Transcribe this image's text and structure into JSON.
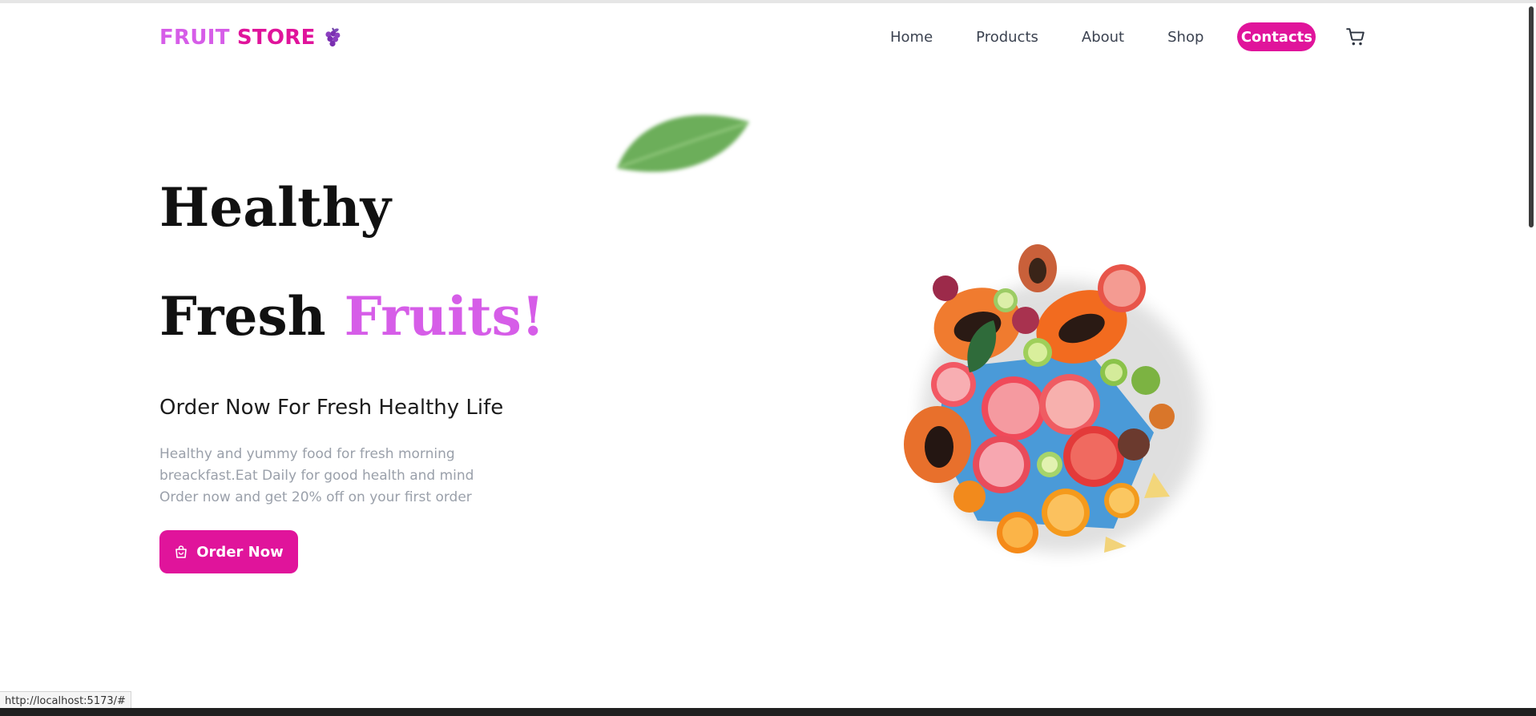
{
  "brand": {
    "word1": "FRUIT",
    "word2": "STORE",
    "icon": "grape-icon"
  },
  "nav": {
    "links": [
      "Home",
      "Products",
      "About",
      "Shop"
    ],
    "contact_label": "Contacts",
    "cart_icon": "cart-icon"
  },
  "hero": {
    "line1": "Healthy",
    "line2_plain": "Fresh",
    "line2_accent": "Fruits!",
    "subheading": "Order Now For Fresh Healthy Life",
    "description": "Healthy and yummy food for fresh morning breackfast.Eat Daily for good health and mind Order now and get 20% off on your first order",
    "cta_label": "Order Now",
    "cta_icon": "shopping-bag-icon"
  },
  "status_bar": {
    "url": "http://localhost:5173/#"
  },
  "colors": {
    "primary": "#e0149b",
    "accent": "#d65de8",
    "heading": "#111111",
    "nav_text": "#3b4250",
    "muted_text": "#9aa0aa"
  }
}
